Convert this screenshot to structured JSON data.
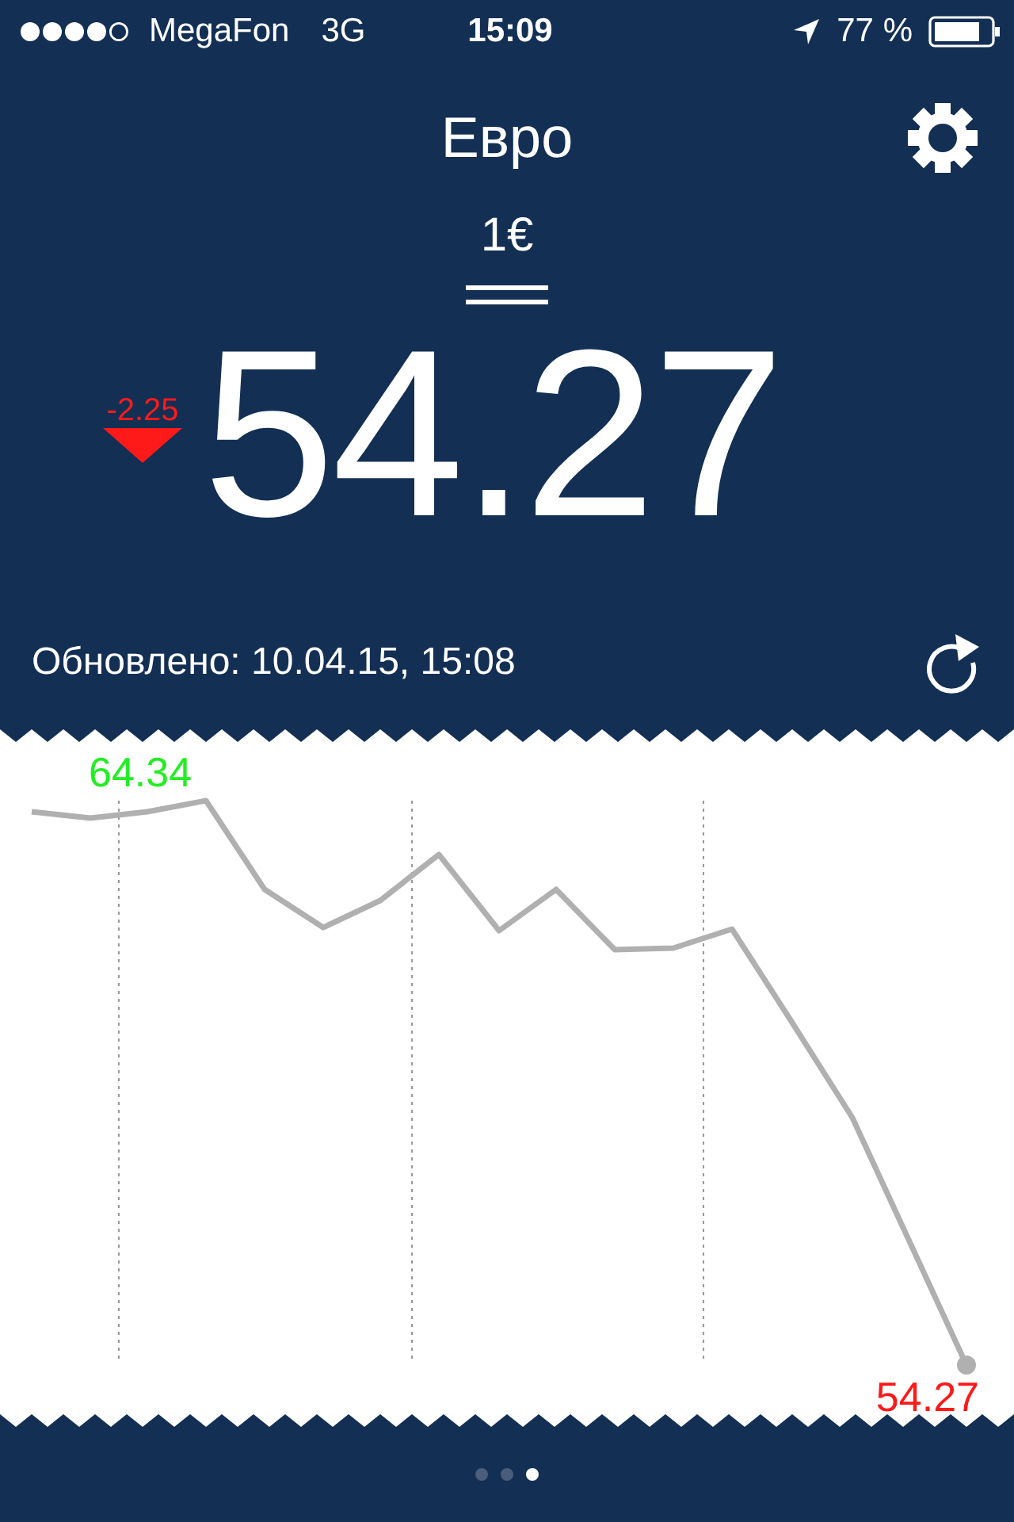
{
  "status_bar": {
    "carrier": "MegaFon",
    "network": "3G",
    "time": "15:09",
    "battery": "77 %"
  },
  "header": {
    "title": "Евро",
    "amount": "1€",
    "rate": "54.27",
    "change": "-2.25",
    "falling": true,
    "updated": "Обновлено: 10.04.15, 15:08"
  },
  "chart": {
    "max_label": "64.34",
    "min_label": "54.27"
  },
  "page_dots": [
    {
      "selected": false
    },
    {
      "selected": false
    },
    {
      "selected": true
    }
  ]
}
